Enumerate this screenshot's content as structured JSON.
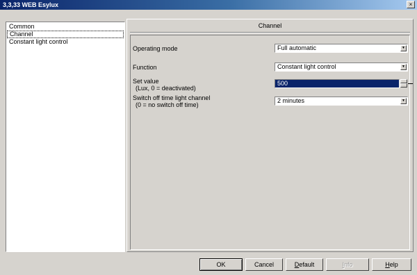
{
  "window": {
    "title": "3,3,33 WEB Esylux",
    "close_symbol": "×"
  },
  "sidebar": {
    "items": [
      {
        "label": "Common"
      },
      {
        "label": "Channel",
        "selected": true
      },
      {
        "label": "Constant light control"
      }
    ]
  },
  "panel": {
    "title": "Channel",
    "params": [
      {
        "label": "Operating mode",
        "value": "Full automatic"
      },
      {
        "label": "Function",
        "value": "Constant light control"
      },
      {
        "label": "Set value",
        "sublabel": "(Lux, 0 = deactivated)",
        "value": "500"
      },
      {
        "label": "Switch off time light channel",
        "sublabel": "(0 = no switch off time)",
        "value": "2 minutes"
      }
    ]
  },
  "footer": {
    "ok": "OK",
    "cancel": "Cancel",
    "default_prefix": "D",
    "default_rest": "efault",
    "info_prefix": "I",
    "info_rest": "nfo",
    "help_prefix": "H",
    "help_rest": "elp"
  },
  "icons": {
    "dropdown": "chevron-down-icon",
    "spin_up": "triangle-up-icon",
    "spin_down": "triangle-down-icon"
  },
  "colors": {
    "titlebar_start": "#0a246a",
    "titlebar_end": "#a6caf0",
    "face": "#d6d3ce",
    "selection": "#0a246a"
  }
}
